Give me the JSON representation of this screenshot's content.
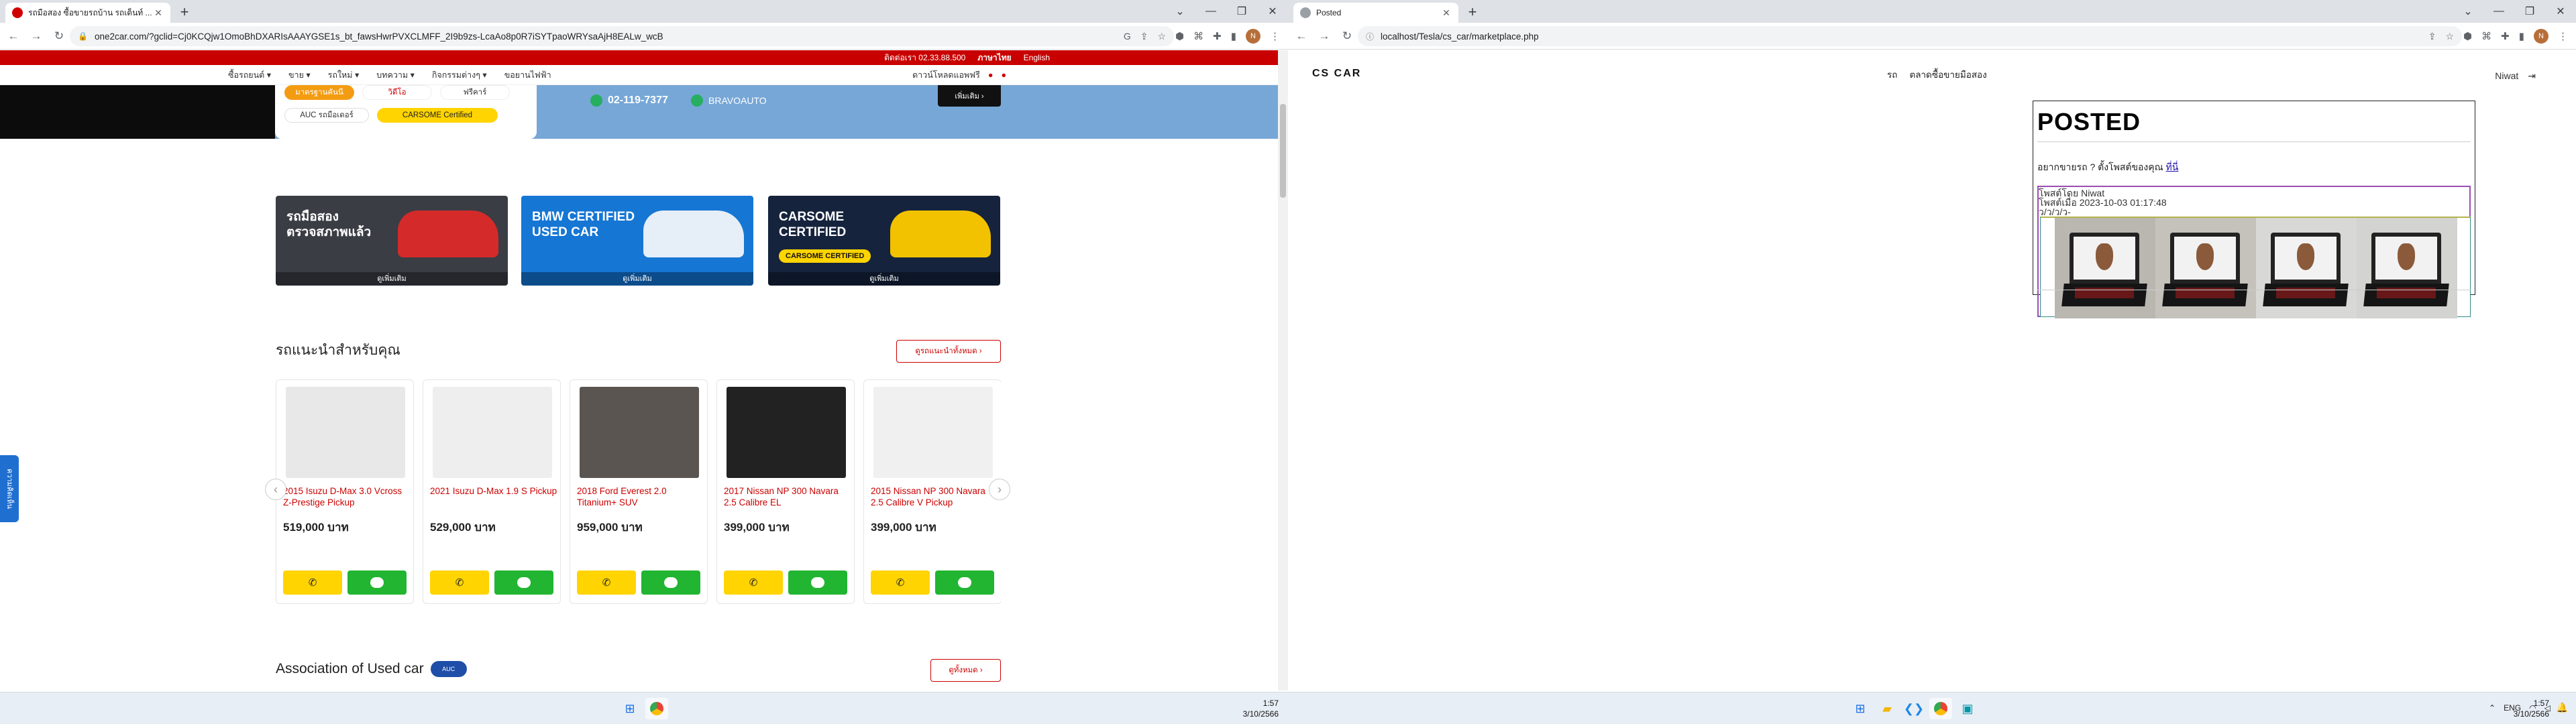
{
  "left": {
    "tab_title": "รถมือสอง ซื้อขายรถบ้าน รถเต็นท์ ...",
    "url": "one2car.com/?gclid=Cj0KCQjw1OmoBhDXARIsAAAYGSE1s_bt_fawsHwrPVXCLMFF_2I9b9zs-LcaAo8p0R7iSYTpaoWRYsaAjH8EALw_wcB",
    "topbar": {
      "contact": "ติดต่อเรา 02.33.88.500",
      "lang_th": "ภาษาไทย",
      "lang_en": "English"
    },
    "menu": [
      "ซื้อรถยนต์ ▾",
      "ขาย ▾",
      "รถใหม่ ▾",
      "บทความ ▾",
      "กิจกรรมต่างๆ ▾",
      "ขอยานไฟฟ้า"
    ],
    "app_download": "ดาวน์โหลดแอพฟรี",
    "hero": {
      "pills": [
        "มาตรฐานคันนี",
        "วิดีโอ",
        "ฟรีคาร์"
      ],
      "auc": "AUC รถมือเดอร์",
      "carsome": "CARSOME Certified",
      "phone": "02-119-7377",
      "line": "BRAVOAUTO",
      "more": "เพิ่มเติม ›"
    },
    "banners": [
      {
        "title1": "รถมือสอง",
        "title2": "ตรวจสภาพแล้ว",
        "footer": "ดูเพิ่มเติม",
        "color": "#3a3d44"
      },
      {
        "title1": "BMW CERTIFIED",
        "title2": "USED CAR",
        "footer": "ดูเพิ่มเติม",
        "color": "#1576d4"
      },
      {
        "title1": "CARSOME",
        "title2": "CERTIFIED",
        "badge": "CARSOME CERTIFIED",
        "footer": "ดูเพิ่มเติม",
        "color": "#15233d"
      }
    ],
    "recommend": {
      "title": "รถแนะนำสำหรับคุณ",
      "button": "ดูรถแนะนำทั้งหมด ›"
    },
    "cars": [
      {
        "name": "2015 Isuzu D-Max 3.0 Vcross Z-Prestige Pickup",
        "price": "519,000 บาท",
        "color": "#e8e8e8"
      },
      {
        "name": "2021 Isuzu D-Max 1.9 S Pickup",
        "price": "529,000 บาท",
        "color": "#eeeeee"
      },
      {
        "name": "2018 Ford Everest 2.0 Titanium+ SUV",
        "price": "959,000 บาท",
        "color": "#5a5550"
      },
      {
        "name": "2017 Nissan NP 300 Navara 2.5 Calibre EL",
        "price": "399,000 บาท",
        "color": "#222222"
      },
      {
        "name": "2015 Nissan NP 300 Navara 2.5 Calibre V Pickup",
        "price": "399,000 บาท",
        "color": "#f0f0f0"
      }
    ],
    "side_tag": "ความคิดเห็น",
    "association": {
      "title": "Association of Used car",
      "logo": "AUC",
      "button": "ดูทั้งหมด ›"
    }
  },
  "right": {
    "tab_title": "Posted",
    "url": "localhost/Tesla/cs_car/marketplace.php",
    "logo": "CS CAR",
    "nav": [
      "รถ",
      "ตลาดซื้อขายมือสอง"
    ],
    "user": "Niwat",
    "page_title": "POSTED",
    "lead_text": "อยากขายรถ ? ตั้งโพสต์ของคุณ",
    "lead_link": "ที่นี่",
    "post": {
      "by_label": "โพสต์โดย",
      "by": "Niwat",
      "at_label": "โพสต์เมื่อ",
      "at": "2023-10-03 01:17:48",
      "extra": "ว/ว/ว/ว-",
      "images": [
        {
          "alt": "laptop"
        },
        {
          "alt": "laptop"
        },
        {
          "alt": "laptop"
        },
        {
          "alt": "laptop"
        }
      ]
    }
  },
  "taskbar": {
    "left": {
      "time": "1:57",
      "date": "3/10/2566"
    },
    "right": {
      "lang": "ENG",
      "time": "1:57",
      "date": "3/10/2566"
    }
  },
  "icons": [
    "lock-icon",
    "back-icon",
    "forward-icon",
    "reload-icon",
    "windows-icon",
    "chrome-icon",
    "explorer-icon",
    "vscode-icon",
    "wifi-icon",
    "volume-icon",
    "battery-icon"
  ]
}
